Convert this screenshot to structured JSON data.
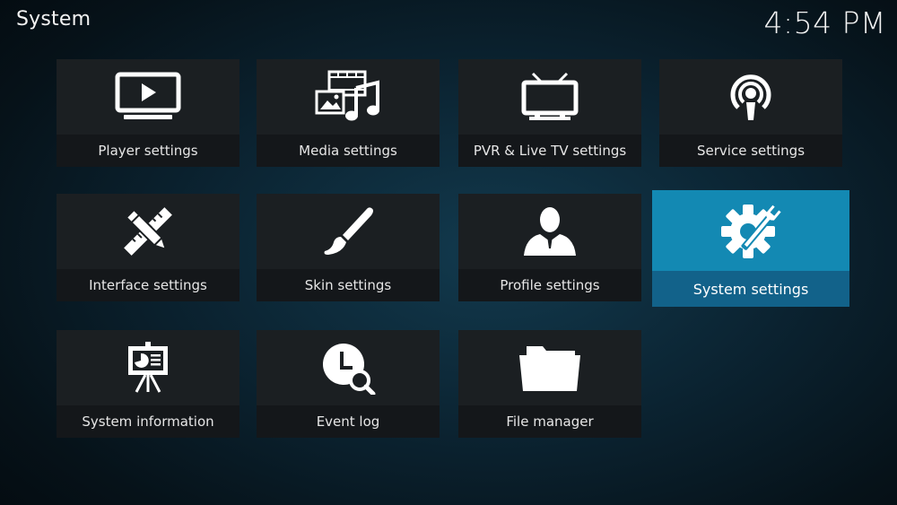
{
  "header": {
    "title": "System",
    "clock": "4:54 PM"
  },
  "tiles": [
    {
      "label": "Player settings",
      "icon": "monitor-play-icon"
    },
    {
      "label": "Media settings",
      "icon": "media-icon"
    },
    {
      "label": "PVR & Live TV settings",
      "icon": "tv-icon"
    },
    {
      "label": "Service settings",
      "icon": "broadcast-icon"
    },
    {
      "label": "Interface settings",
      "icon": "pencil-ruler-icon"
    },
    {
      "label": "Skin settings",
      "icon": "paintbrush-icon"
    },
    {
      "label": "Profile settings",
      "icon": "user-icon"
    },
    {
      "label": "System settings",
      "icon": "gear-wrench-icon"
    },
    {
      "label": "System information",
      "icon": "presentation-easel-icon"
    },
    {
      "label": "Event log",
      "icon": "clock-search-icon"
    },
    {
      "label": "File manager",
      "icon": "folder-icon"
    }
  ],
  "focused_tile": "System settings",
  "colors": {
    "accent": "#1389b3",
    "accent_label": "#12628a",
    "tile_bg": "#1b1f22",
    "label_bg": "#14171a"
  }
}
